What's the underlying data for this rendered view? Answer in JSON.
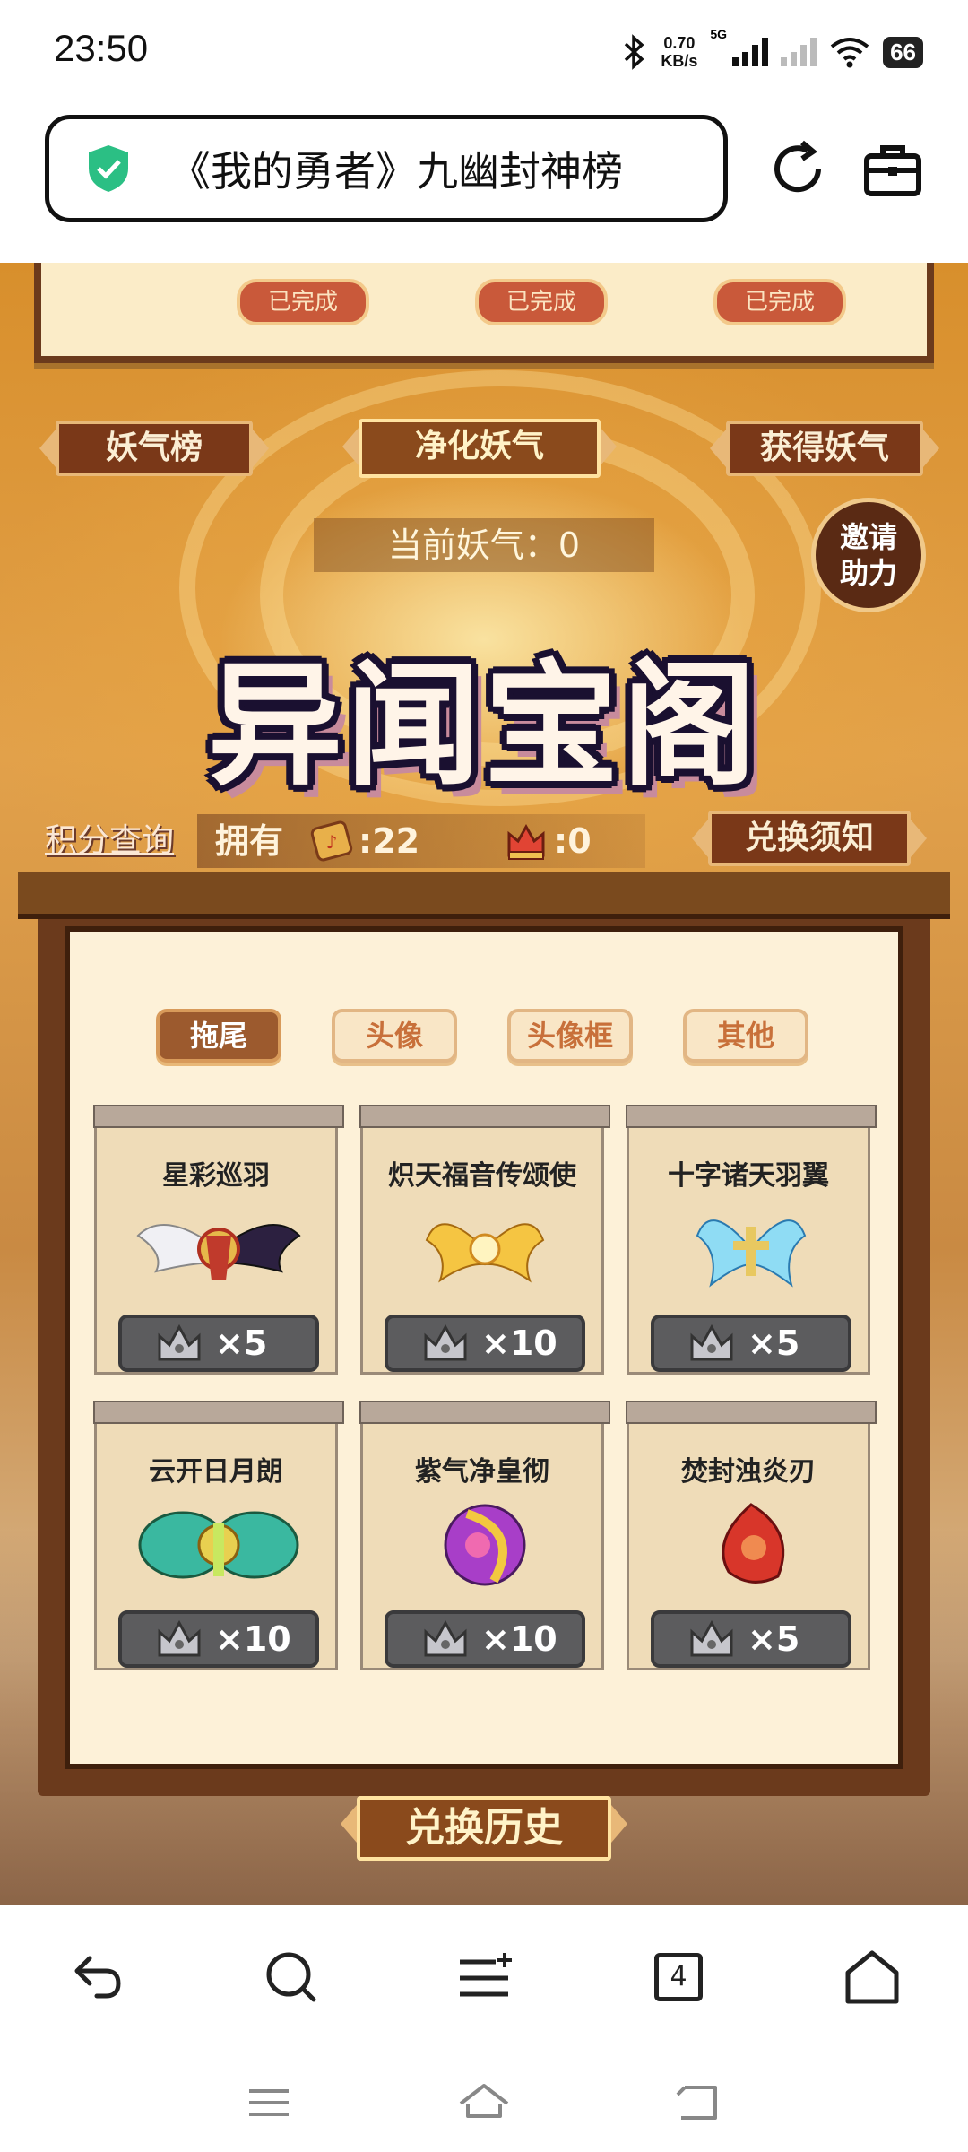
{
  "status": {
    "time": "23:50",
    "net_speed_value": "0.70",
    "net_speed_unit": "KB/s",
    "network": "5G",
    "battery": "66"
  },
  "browser": {
    "url_title": "《我的勇者》九幽封神榜"
  },
  "game": {
    "completed_labels": [
      "已完成",
      "已完成",
      "已完成"
    ],
    "left_plaque": "妖气榜",
    "center_plaque": "净化妖气",
    "right_plaque": "获得妖气",
    "current_yaoqi": "当前妖气：0",
    "invite_line1": "邀请",
    "invite_line2": "助力",
    "title": "异闻宝阁",
    "points_query": "积分查询",
    "owned_label": "拥有",
    "token_a_count": ":22",
    "token_b_count": ":0",
    "exchange_notice": "兑换须知",
    "tabs": [
      {
        "label": "拖尾",
        "active": true
      },
      {
        "label": "头像",
        "active": false
      },
      {
        "label": "头像框",
        "active": false
      },
      {
        "label": "其他",
        "active": false
      }
    ],
    "items": [
      {
        "name": "星彩巡羽",
        "price": "×5",
        "icon": "wings-rainbow-icon"
      },
      {
        "name": "炽天福音传颂使",
        "price": "×10",
        "icon": "golden-wings-icon"
      },
      {
        "name": "十字诸天羽翼",
        "price": "×5",
        "icon": "blue-cross-wings-icon"
      },
      {
        "name": "云开日月朗",
        "price": "×10",
        "icon": "cloud-dragon-icon"
      },
      {
        "name": "紫气净皇彻",
        "price": "×10",
        "icon": "purple-flame-icon"
      },
      {
        "name": "焚封浊炎刃",
        "price": "×5",
        "icon": "red-blade-icon"
      }
    ],
    "history": "兑换历史"
  },
  "toolbar": {
    "tab_count": "4"
  },
  "colors": {
    "panel_bg": "#fdf1d8",
    "frame_brown": "#6b3a1c",
    "active_tab": "#9c5a2e",
    "price_bg": "#5c5c5e",
    "shield_green": "#2bbf84"
  }
}
